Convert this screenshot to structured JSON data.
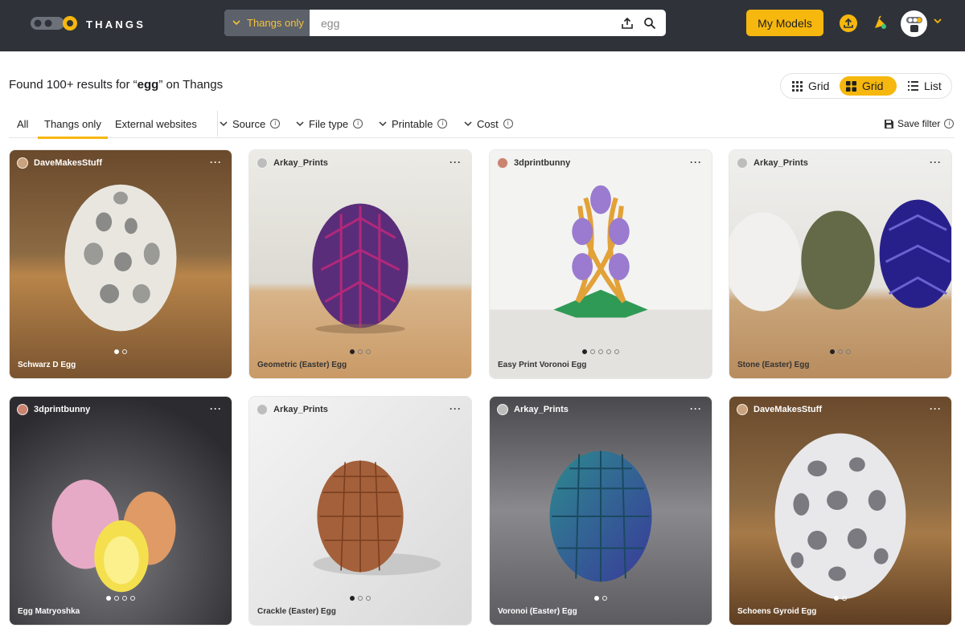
{
  "app": {
    "brand": "THANGS"
  },
  "search": {
    "scope_label": "Thangs only",
    "placeholder": "egg"
  },
  "header": {
    "my_models_label": "My Models"
  },
  "results": {
    "prefix": "Found 100+ results for “",
    "query": "egg",
    "suffix": "” on Thangs"
  },
  "view": {
    "options": [
      "Grid",
      "Grid",
      "List"
    ],
    "active_index": 1
  },
  "filters": {
    "tabs": [
      "All",
      "Thangs only",
      "External websites"
    ],
    "active_tab": "Thangs only",
    "dropdowns": [
      "Source",
      "File type",
      "Printable",
      "Cost"
    ],
    "save_label": "Save filter"
  },
  "colors": {
    "accent": "#f6b70e",
    "topbar": "#2f3339",
    "scope_bg": "#5c616a"
  },
  "cards": [
    {
      "author": "DaveMakesStuff",
      "title": "Schwarz D Egg",
      "dots": 2,
      "active_dot": 0
    },
    {
      "author": "Arkay_Prints",
      "title": "Geometric (Easter) Egg",
      "dots": 3,
      "active_dot": 0
    },
    {
      "author": "3dprintbunny",
      "title": "Easy Print Voronoi Egg",
      "dots": 5,
      "active_dot": 0
    },
    {
      "author": "Arkay_Prints",
      "title": "Stone (Easter) Egg",
      "dots": 3,
      "active_dot": 0
    },
    {
      "author": "3dprintbunny",
      "title": "Egg Matryoshka",
      "dots": 4,
      "active_dot": 0
    },
    {
      "author": "Arkay_Prints",
      "title": "Crackle (Easter) Egg",
      "dots": 3,
      "active_dot": 0
    },
    {
      "author": "Arkay_Prints",
      "title": "Voronoi (Easter) Egg",
      "dots": 2,
      "active_dot": 0
    },
    {
      "author": "DaveMakesStuff",
      "title": "Schoens Gyroid Egg",
      "dots": 2,
      "active_dot": 0
    }
  ]
}
